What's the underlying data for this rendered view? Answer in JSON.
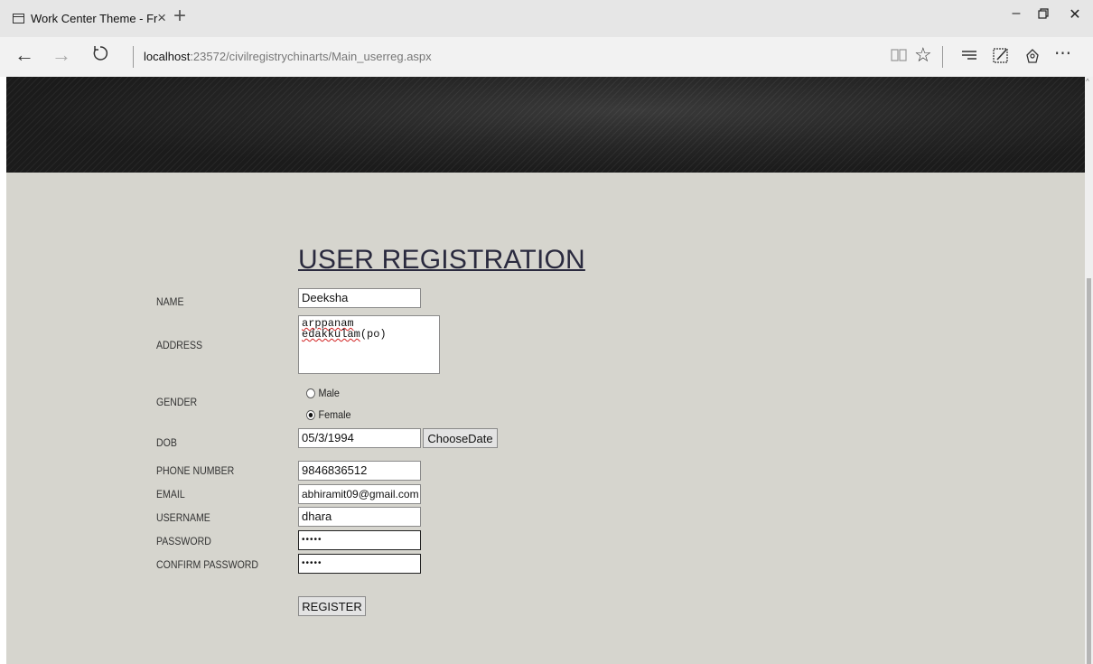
{
  "browser": {
    "tab_title": "Work Center Theme - Fr",
    "tab_close": "×",
    "new_tab": "+",
    "url_host": "localhost",
    "url_path": ":23572/civilregistrychinarts/Main_userreg.aspx",
    "icons": [
      "back-icon",
      "forward-icon",
      "refresh-icon",
      "reading-view-icon",
      "favorite-star-icon",
      "hub-icon",
      "web-note-icon",
      "share-icon",
      "more-icon"
    ]
  },
  "form": {
    "heading": "USER REGISTRATION",
    "labels": {
      "name": "NAME",
      "address": "ADDRESS",
      "gender": "GENDER",
      "dob": "DOB",
      "phone": "PHONE NUMBER",
      "email": "EMAIL",
      "username": "USERNAME",
      "password": "PASSWORD",
      "confirm_password": "CONFIRM PASSWORD"
    },
    "values": {
      "name": "Deeksha",
      "address_line1": "arppanam",
      "address_line2_word": "edakkulam",
      "address_line2_suffix": "(po)",
      "dob": "05/3/1994",
      "phone": "9846836512",
      "email": "abhiramit09@gmail.com",
      "username": "dhara",
      "password_mask": "•••••",
      "confirm_password_mask": "•••••"
    },
    "gender_options": [
      "Male",
      "Female"
    ],
    "gender_selected": "Female",
    "choose_date_label": "ChooseDate",
    "register_label": "REGISTER"
  }
}
